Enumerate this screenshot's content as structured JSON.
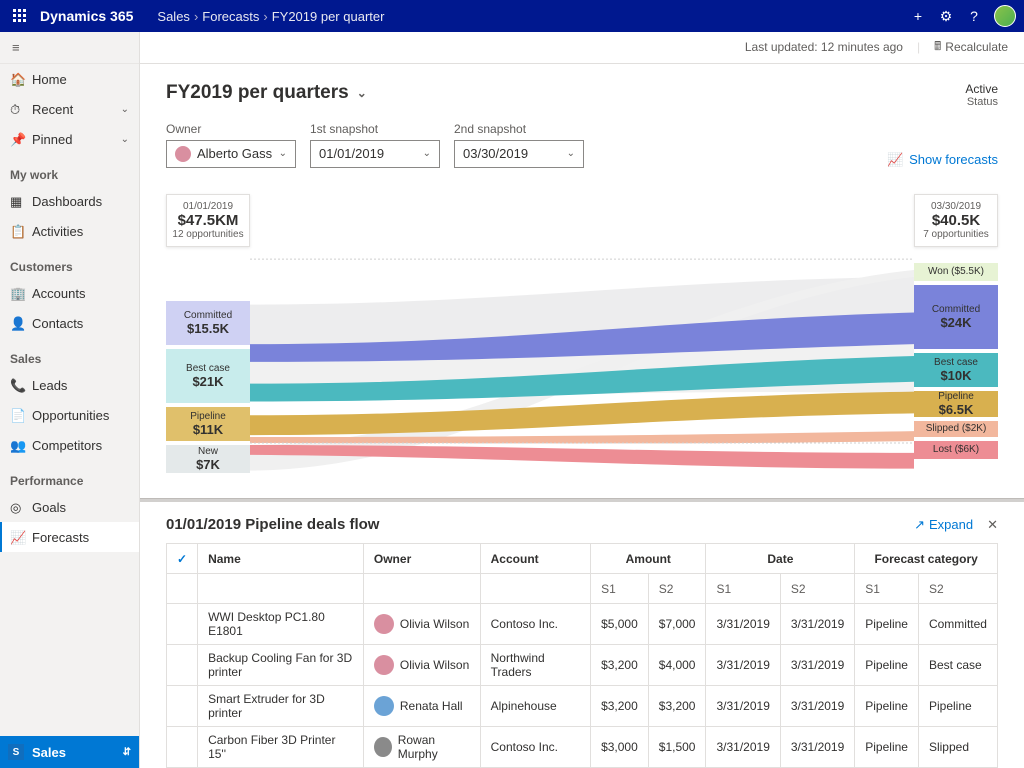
{
  "topbar": {
    "brand": "Dynamics 365",
    "crumbs": [
      "Sales",
      "Forecasts",
      "FY2019 per quarter"
    ],
    "icons": {
      "add": "+",
      "settings": "⚙",
      "help": "?"
    }
  },
  "sidebar": {
    "top": [
      {
        "icon": "🏠",
        "label": "Home",
        "chev": false
      },
      {
        "icon": "⏱",
        "label": "Recent",
        "chev": true
      },
      {
        "icon": "📌",
        "label": "Pinned",
        "chev": true
      }
    ],
    "sections": [
      {
        "title": "My work",
        "items": [
          {
            "icon": "▦",
            "label": "Dashboards"
          },
          {
            "icon": "📋",
            "label": "Activities"
          }
        ]
      },
      {
        "title": "Customers",
        "items": [
          {
            "icon": "🏢",
            "label": "Accounts"
          },
          {
            "icon": "👤",
            "label": "Contacts"
          }
        ]
      },
      {
        "title": "Sales",
        "items": [
          {
            "icon": "📞",
            "label": "Leads"
          },
          {
            "icon": "📄",
            "label": "Opportunities"
          },
          {
            "icon": "👥",
            "label": "Competitors"
          }
        ]
      },
      {
        "title": "Performance",
        "items": [
          {
            "icon": "◎",
            "label": "Goals"
          },
          {
            "icon": "📈",
            "label": "Forecasts",
            "active": true
          }
        ]
      }
    ],
    "footer": {
      "letter": "S",
      "label": "Sales"
    }
  },
  "cmdbar": {
    "last_updated": "Last updated: 12 minutes ago",
    "recalculate": "Recalculate"
  },
  "header": {
    "title": "FY2019 per quarters",
    "status_value": "Active",
    "status_label": "Status"
  },
  "filters": {
    "owner_label": "Owner",
    "owner_value": "Alberto Gass",
    "snap1_label": "1st snapshot",
    "snap1_value": "01/01/2019",
    "snap2_label": "2nd snapshot",
    "snap2_value": "03/30/2019",
    "show_forecasts": "Show forecasts"
  },
  "snapshots": {
    "left": {
      "date": "01/01/2019",
      "value": "$47.5KM",
      "opps": "12 opportunities"
    },
    "right": {
      "date": "03/30/2019",
      "value": "$40.5K",
      "opps": "7 opportunities"
    }
  },
  "left_stages": [
    {
      "name": "Committed",
      "value": "$15.5K",
      "color": "#cfd1f3",
      "h": 44
    },
    {
      "name": "Best case",
      "value": "$21K",
      "color": "#c8ecec",
      "h": 54
    },
    {
      "name": "Pipeline",
      "value": "$11K",
      "color": "#e0c06b",
      "h": 34
    },
    {
      "name": "New",
      "value": "$7K",
      "color": "#e4e9ea",
      "h": 28
    }
  ],
  "right_stages": [
    {
      "name": "Won ($5.5K)",
      "value": "",
      "color": "#e7f3d4",
      "h": 18
    },
    {
      "name": "Committed",
      "value": "$24K",
      "color": "#7a83da",
      "h": 64
    },
    {
      "name": "Best case",
      "value": "$10K",
      "color": "#4bb9bf",
      "h": 34
    },
    {
      "name": "Pipeline",
      "value": "$6.5K",
      "color": "#d8b04f",
      "h": 26
    },
    {
      "name": "Slipped ($2K)",
      "value": "",
      "color": "#f2b79d",
      "h": 16
    },
    {
      "name": "Lost ($6K)",
      "value": "",
      "color": "#ed8d94",
      "h": 18
    }
  ],
  "chart_data": {
    "type": "area",
    "title": "Pipeline snapshot comparison (sankey)",
    "left": {
      "date": "01/01/2019",
      "total": 47.5,
      "opportunities": 12,
      "stages": {
        "Committed": 15.5,
        "Best case": 21,
        "Pipeline": 11,
        "New": 7
      }
    },
    "right": {
      "date": "03/30/2019",
      "total": 40.5,
      "opportunities": 7,
      "stages": {
        "Won": 5.5,
        "Committed": 24,
        "Best case": 10,
        "Pipeline": 6.5,
        "Slipped": 2,
        "Lost": 6
      }
    },
    "unit": "$K"
  },
  "deals": {
    "title": "01/01/2019 Pipeline deals flow",
    "expand": "Expand",
    "columns": [
      "Name",
      "Owner",
      "Account",
      "Amount",
      "Date",
      "Forecast category"
    ],
    "sub": [
      "",
      "",
      "",
      "S1",
      "S2",
      "S1",
      "S2",
      "S1",
      "S2"
    ],
    "rows": [
      {
        "name": "WWI Desktop PC1.80 E1801",
        "owner": "Olivia Wilson",
        "av": "#d98fa0",
        "acct": "Contoso Inc.",
        "a1": "$5,000",
        "a2": "$7,000",
        "d1": "3/31/2019",
        "d2": "3/31/2019",
        "f1": "Pipeline",
        "f2": "Committed"
      },
      {
        "name": "Backup Cooling Fan for 3D printer",
        "owner": "Olivia Wilson",
        "av": "#d98fa0",
        "acct": "Northwind Traders",
        "a1": "$3,200",
        "a2": "$4,000",
        "d1": "3/31/2019",
        "d2": "3/31/2019",
        "f1": "Pipeline",
        "f2": "Best case"
      },
      {
        "name": "Smart Extruder for 3D printer",
        "owner": "Renata Hall",
        "av": "#6ba3d6",
        "acct": "Alpinehouse",
        "a1": "$3,200",
        "a2": "$3,200",
        "d1": "3/31/2019",
        "d2": "3/31/2019",
        "f1": "Pipeline",
        "f2": "Pipeline"
      },
      {
        "name": "Carbon Fiber 3D Printer 15''",
        "owner": "Rowan Murphy",
        "av": "#8a8a8a",
        "acct": "Contoso Inc.",
        "a1": "$3,000",
        "a2": "$1,500",
        "d1": "3/31/2019",
        "d2": "3/31/2019",
        "f1": "Pipeline",
        "f2": "Slipped"
      }
    ]
  }
}
